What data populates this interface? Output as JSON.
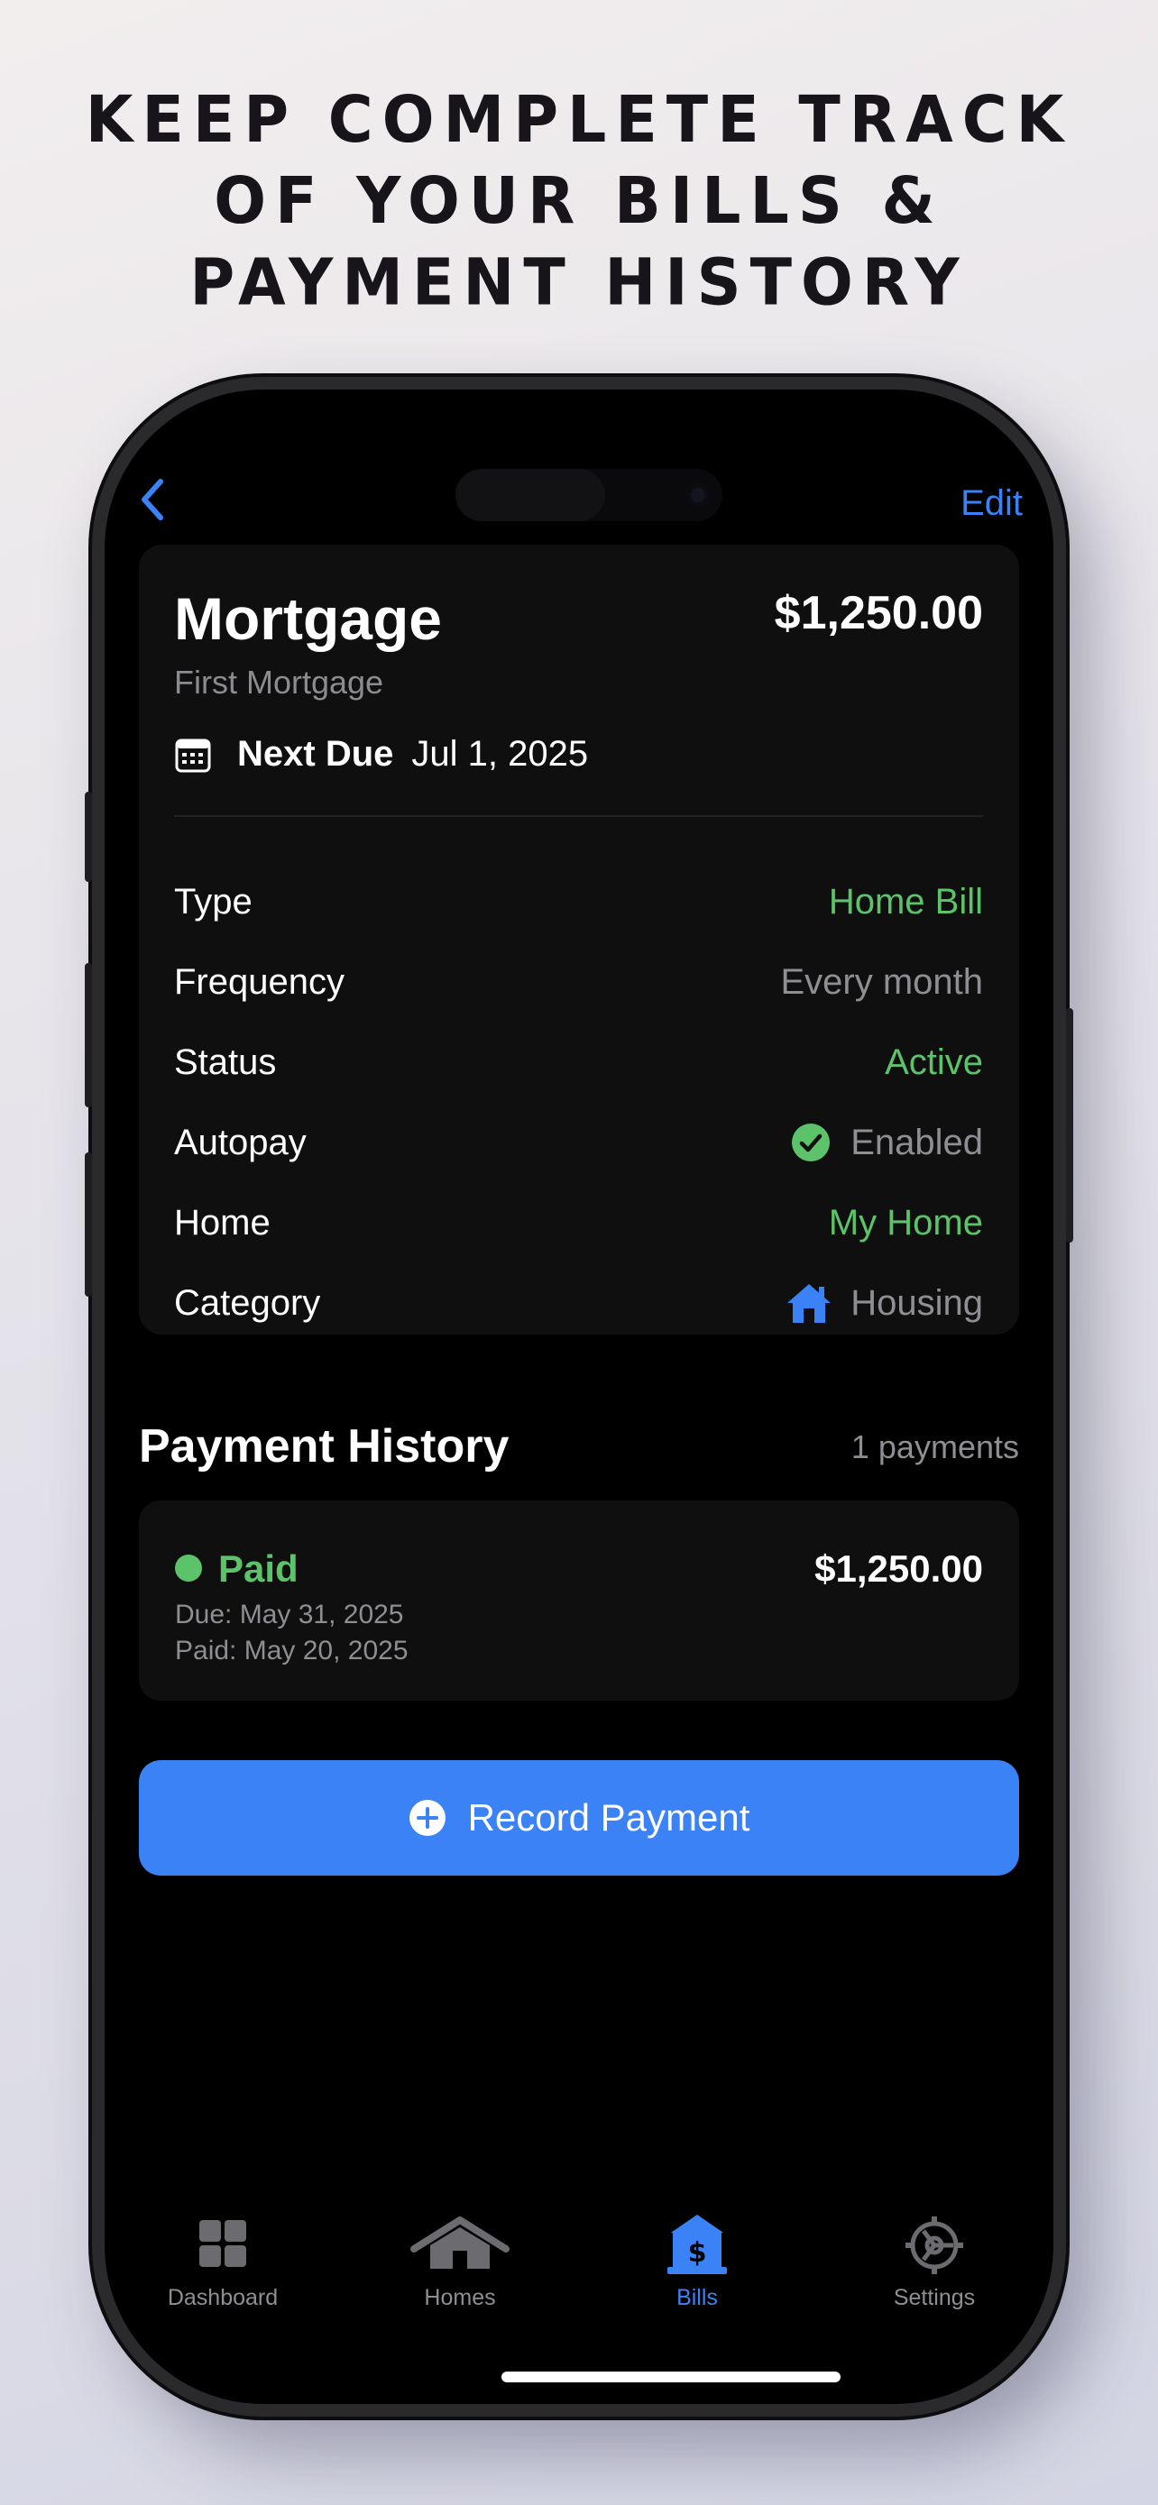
{
  "headline": {
    "line1": "KEEP COMPLETE TRACK",
    "line2": "OF YOUR BILLS &",
    "line3": "PAYMENT HISTORY"
  },
  "nav": {
    "back_icon": "chevron-left-icon",
    "edit_label": "Edit"
  },
  "bill": {
    "title": "Mortgage",
    "amount": "$1,250.00",
    "subtitle": "First Mortgage",
    "due_label": "Next Due",
    "due_date": "Jul 1, 2025",
    "details": [
      {
        "label": "Type",
        "value": "Home Bill"
      },
      {
        "label": "Frequency",
        "value": "Every month"
      },
      {
        "label": "Status",
        "value": "Active"
      },
      {
        "label": "Autopay",
        "value": "Enabled"
      },
      {
        "label": "Home",
        "value": "My Home"
      },
      {
        "label": "Category",
        "value": "Housing"
      }
    ]
  },
  "history": {
    "title": "Payment History",
    "count": "1 payments",
    "payments": [
      {
        "status": "Paid",
        "amount": "$1,250.00",
        "due": "Due: May 31, 2025",
        "paid": "Paid: May 20, 2025"
      }
    ]
  },
  "record_button": {
    "label": "Record Payment",
    "icon": "plus-circle-icon"
  },
  "tabbar": {
    "items": [
      {
        "label": "Dashboard",
        "icon": "grid-icon"
      },
      {
        "label": "Homes",
        "icon": "house-icon"
      },
      {
        "label": "Bills",
        "icon": "bank-dollar-icon"
      },
      {
        "label": "Settings",
        "icon": "gear-icon"
      }
    ],
    "active": "Bills"
  },
  "colors": {
    "accent": "#3b82f6",
    "green": "#5dc36a",
    "secondary_text": "#8e8e93",
    "card": "#0f0f10"
  }
}
